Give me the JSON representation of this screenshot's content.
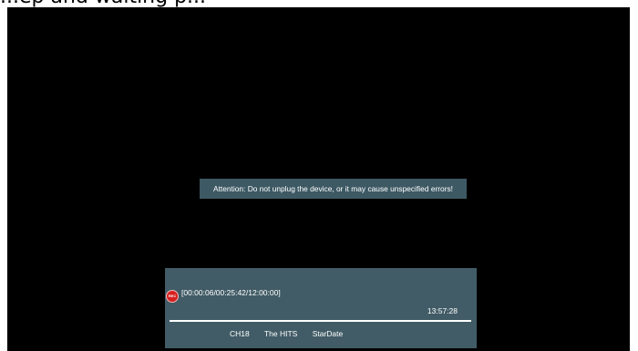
{
  "caption": "...ep and waiting p...",
  "toast": {
    "message": "Attention: Do not unplug the device, or it may cause unspecified errors!"
  },
  "recording": {
    "badge_label": "REC",
    "timeline": "[00:00:06/00:25:42/12:00:00]",
    "clock": "13:57:28",
    "progress_fraction": 1.0,
    "channel": "CH18",
    "station": "The HITS",
    "program": "StarDate"
  },
  "colors": {
    "screen": "#000000",
    "panel": "#415c66",
    "toast": "#3d5964",
    "rec_badge": "#d71f1f"
  }
}
